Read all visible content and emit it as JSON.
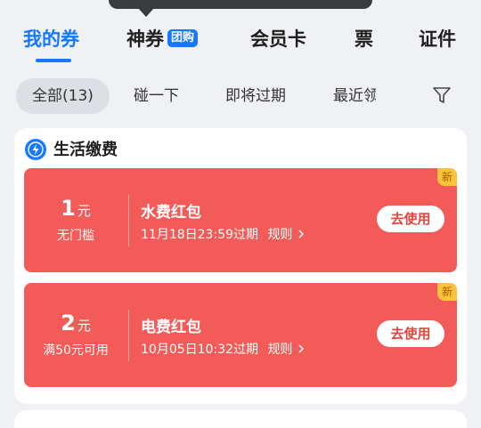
{
  "tabs": [
    {
      "label": "我的券"
    },
    {
      "label": "神券",
      "badge": "团购"
    },
    {
      "label": "会员卡"
    },
    {
      "label": "票"
    },
    {
      "label": "证件"
    }
  ],
  "filters": [
    "全部(13)",
    "碰一下",
    "即将过期",
    "最近领"
  ],
  "section": {
    "title": "生活缴费",
    "icon": "lightning-icon"
  },
  "coupons": [
    {
      "amount": "1",
      "unit": "元",
      "condition": "无门槛",
      "name": "水费红包",
      "expiry": "11月18日23:59过期",
      "rule_label": "规则",
      "button": "去使用",
      "badge": "新"
    },
    {
      "amount": "2",
      "unit": "元",
      "condition": "满50元可用",
      "name": "电费红包",
      "expiry": "10月05日10:32过期",
      "rule_label": "规则",
      "button": "去使用",
      "badge": "新"
    }
  ],
  "colors": {
    "accent": "#1677ff",
    "coupon_bg": "#f25b57",
    "badge_bg": "#f9c43b"
  }
}
